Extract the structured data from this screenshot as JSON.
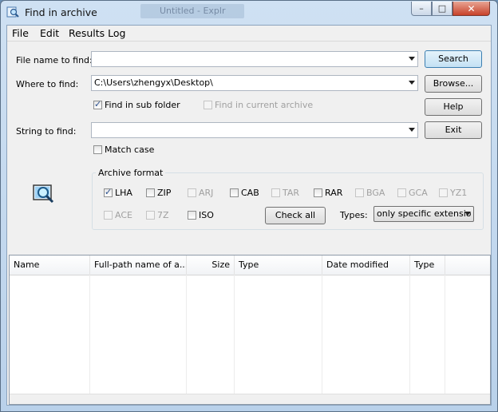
{
  "window": {
    "title": "Find in archive",
    "background_title": "Untitled - Explr",
    "controls": {
      "minimize": "–",
      "maximize": "□",
      "close": "✕"
    }
  },
  "menu": [
    "File",
    "Edit",
    "Results Log"
  ],
  "labels": {
    "file_name": "File name to find:",
    "where": "Where to find:",
    "string": "String to find:"
  },
  "fields": {
    "file_name_value": "",
    "where_value": "C:\\Users\\zhengyx\\Desktop\\",
    "string_value": ""
  },
  "buttons": {
    "search": "Search",
    "browse": "Browse...",
    "help": "Help",
    "exit": "Exit",
    "check_all": "Check all"
  },
  "options": {
    "subfolder": {
      "label": "Find in sub folder",
      "checked": true
    },
    "current_archive": {
      "label": "Find in current archive",
      "checked": false,
      "enabled": false
    },
    "match_case": {
      "label": "Match case",
      "checked": false
    }
  },
  "archive_format": {
    "title": "Archive format",
    "row1": [
      {
        "label": "LHA",
        "checked": true,
        "enabled": true
      },
      {
        "label": "ZIP",
        "checked": false,
        "enabled": true
      },
      {
        "label": "ARJ",
        "checked": false,
        "enabled": false
      },
      {
        "label": "CAB",
        "checked": false,
        "enabled": true
      },
      {
        "label": "TAR",
        "checked": false,
        "enabled": false
      },
      {
        "label": "RAR",
        "checked": false,
        "enabled": true
      },
      {
        "label": "BGA",
        "checked": false,
        "enabled": false
      },
      {
        "label": "GCA",
        "checked": false,
        "enabled": false
      },
      {
        "label": "YZ1",
        "checked": false,
        "enabled": false
      }
    ],
    "row2": [
      {
        "label": "ACE",
        "checked": false,
        "enabled": false
      },
      {
        "label": "7Z",
        "checked": false,
        "enabled": false
      },
      {
        "label": "ISO",
        "checked": false,
        "enabled": true
      }
    ],
    "types_label": "Types:",
    "types_value": "only specific extensio"
  },
  "results": {
    "columns": [
      "Name",
      "Full-path name of a...",
      "Size",
      "Type",
      "Date modified",
      "Type"
    ],
    "rows": []
  },
  "colors": {
    "accent": "#3c7fb1",
    "titlebar": "#b9d1ea",
    "close": "#c8412a"
  }
}
